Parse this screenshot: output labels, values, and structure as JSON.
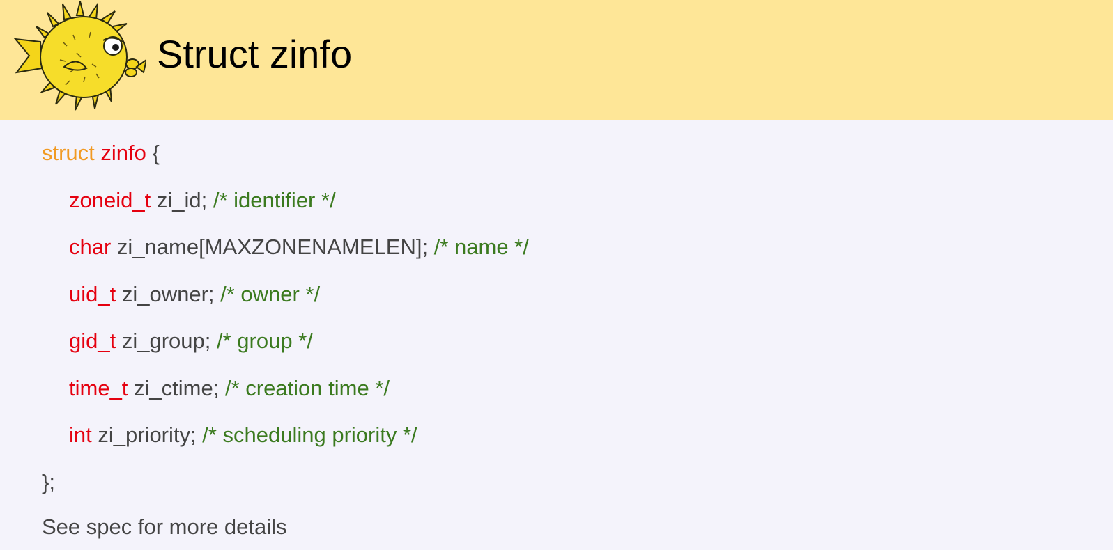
{
  "header": {
    "title": "Struct zinfo",
    "logo_icon": "pufferfish-logo-icon"
  },
  "code": {
    "open": {
      "keyword": "struct",
      "name": "zinfo",
      "brace": " {"
    },
    "fields": [
      {
        "type": "zoneid_t",
        "decl": " zi_id; ",
        "comment": "/* identifier */"
      },
      {
        "type": "char",
        "decl": " zi_name[MAXZONENAMELEN]; ",
        "comment": "/* name */"
      },
      {
        "type": "uid_t",
        "decl": " zi_owner; ",
        "comment": "/* owner */"
      },
      {
        "type": "gid_t",
        "decl": " zi_group; ",
        "comment": "/* group */"
      },
      {
        "type": "time_t",
        "decl": " zi_ctime; ",
        "comment": "/* creation time */"
      },
      {
        "type": "int",
        "decl": " zi_priority; ",
        "comment": "/* scheduling priority */"
      }
    ],
    "close": "};"
  },
  "footer": {
    "text": "See spec for more details"
  },
  "colors": {
    "header_bg": "#fee697",
    "page_bg": "#f4f3fb",
    "struct_keyword": "#f19a23",
    "type_keyword": "#e5000f",
    "comment": "#3b7a1f",
    "text": "#444444"
  }
}
